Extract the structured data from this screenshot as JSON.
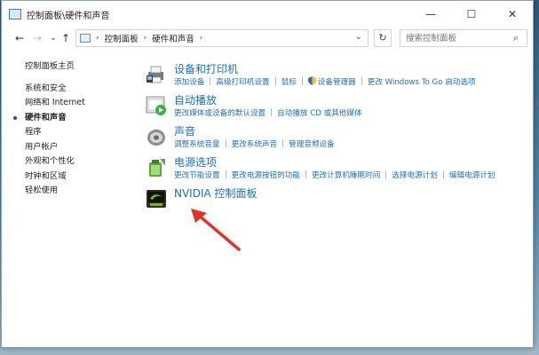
{
  "window": {
    "title": "控制面板\\硬件和声音",
    "controls": {
      "minimize": "—",
      "maximize": "☐",
      "close": "✕"
    }
  },
  "nav": {
    "back": "←",
    "forward": "→",
    "dropdown": "⌄",
    "up": "↑",
    "refresh": "↻"
  },
  "address": {
    "crumbs": [
      "控制面板",
      "硬件和声音"
    ],
    "sep": "›"
  },
  "search": {
    "placeholder": "搜索控制面板",
    "icon": "search-icon"
  },
  "sidebar": {
    "items": [
      {
        "label": "控制面板主页"
      },
      {
        "label": "系统和安全"
      },
      {
        "label": "网络和 Internet"
      },
      {
        "label": "硬件和声音"
      },
      {
        "label": "程序"
      },
      {
        "label": "用户帐户"
      },
      {
        "label": "外观和个性化"
      },
      {
        "label": "时钟和区域"
      },
      {
        "label": "轻松使用"
      }
    ]
  },
  "categories": [
    {
      "title": "设备和打印机",
      "icon": "printer-icon",
      "links": [
        "添加设备",
        "高级打印机设置",
        "鼠标",
        "设备管理器",
        "更改 Windows To Go 启动选项"
      ]
    },
    {
      "title": "自动播放",
      "icon": "autoplay-icon",
      "links": [
        "更改媒体或设备的默认设置",
        "自动播放 CD 或其他媒体"
      ]
    },
    {
      "title": "声音",
      "icon": "speaker-icon",
      "links": [
        "调整系统音量",
        "更改系统声音",
        "管理音频设备"
      ]
    },
    {
      "title": "电源选项",
      "icon": "power-options-icon",
      "links": [
        "更改节能设置",
        "更改电源按钮的功能",
        "更改计算机睡眠时间",
        "选择电源计划",
        "编辑电源计划"
      ]
    },
    {
      "title": "NVIDIA 控制面板",
      "icon": "nvidia-icon",
      "links": []
    }
  ],
  "colors": {
    "link": "#1e6fb8",
    "arrow": "#e0342b"
  }
}
